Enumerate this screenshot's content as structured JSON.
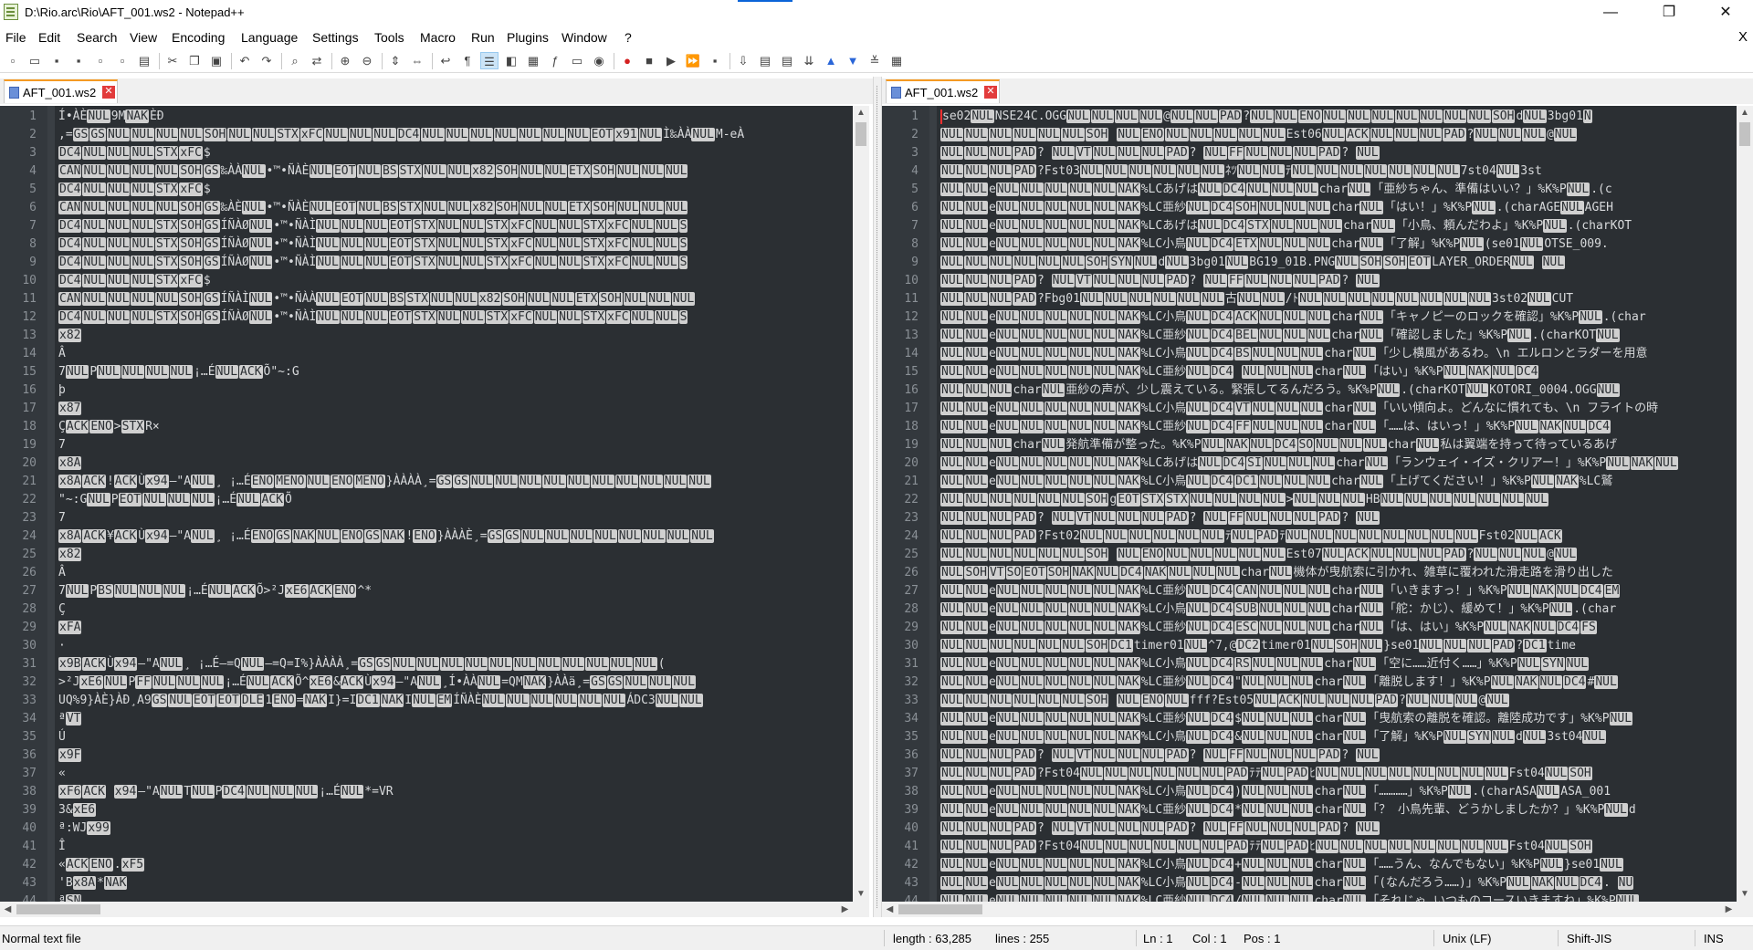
{
  "window": {
    "title": "D:\\Rio.arc\\Rio\\AFT_001.ws2 - Notepad++"
  },
  "menu": [
    "File",
    "Edit",
    "Search",
    "View",
    "Encoding",
    "Language",
    "Settings",
    "Tools",
    "Macro",
    "Run",
    "Plugins",
    "Window",
    "?"
  ],
  "menu_close": "X",
  "toolbar": [
    {
      "icon": "new-file-icon",
      "glyph": "▫"
    },
    {
      "icon": "open-file-icon",
      "glyph": "▭"
    },
    {
      "icon": "save-icon",
      "glyph": "▪"
    },
    {
      "icon": "save-all-icon",
      "glyph": "▪"
    },
    {
      "icon": "close-icon",
      "glyph": "▫"
    },
    {
      "icon": "close-all-icon",
      "glyph": "▫"
    },
    {
      "icon": "print-icon",
      "glyph": "▤"
    },
    {
      "sep": true
    },
    {
      "icon": "cut-icon",
      "glyph": "✂"
    },
    {
      "icon": "copy-icon",
      "glyph": "❐"
    },
    {
      "icon": "paste-icon",
      "glyph": "▣"
    },
    {
      "sep": true
    },
    {
      "icon": "undo-icon",
      "glyph": "↶"
    },
    {
      "icon": "redo-icon",
      "glyph": "↷"
    },
    {
      "sep": true
    },
    {
      "icon": "find-icon",
      "glyph": "⌕"
    },
    {
      "icon": "replace-icon",
      "glyph": "⇄"
    },
    {
      "sep": true
    },
    {
      "icon": "zoom-in-icon",
      "glyph": "⊕"
    },
    {
      "icon": "zoom-out-icon",
      "glyph": "⊖"
    },
    {
      "sep": true
    },
    {
      "icon": "sync-vertical-icon",
      "glyph": "⇕"
    },
    {
      "icon": "sync-horizontal-icon",
      "glyph": "⇔"
    },
    {
      "sep": true
    },
    {
      "icon": "word-wrap-icon",
      "glyph": "↩"
    },
    {
      "icon": "show-all-characters-icon",
      "glyph": "¶"
    },
    {
      "icon": "indent-guide-icon",
      "glyph": "☰",
      "selected": true
    },
    {
      "icon": "language-icon",
      "glyph": "◧"
    },
    {
      "icon": "doc-map-icon",
      "glyph": "▦"
    },
    {
      "icon": "function-list-icon",
      "glyph": "ƒ"
    },
    {
      "icon": "folder-workspace-icon",
      "glyph": "▭"
    },
    {
      "icon": "monitor-icon",
      "glyph": "◉"
    },
    {
      "sep": true
    },
    {
      "icon": "record-macro-icon",
      "glyph": "●",
      "color": "#d42020"
    },
    {
      "icon": "stop-record-icon",
      "glyph": "■"
    },
    {
      "icon": "play-macro-icon",
      "glyph": "▶"
    },
    {
      "icon": "run-macro-multiple-icon",
      "glyph": "⏩"
    },
    {
      "icon": "save-macro-icon",
      "glyph": "▪"
    },
    {
      "sep": true
    },
    {
      "icon": "plugin-1-icon",
      "glyph": "⇩"
    },
    {
      "icon": "plugin-2-icon",
      "glyph": "▤"
    },
    {
      "icon": "plugin-3-icon",
      "glyph": "▤"
    },
    {
      "icon": "plugin-4-icon",
      "glyph": "⇊"
    },
    {
      "icon": "plugin-5-icon",
      "glyph": "▲",
      "color": "#2a66d8"
    },
    {
      "icon": "plugin-6-icon",
      "glyph": "▼",
      "color": "#2a66d8"
    },
    {
      "icon": "plugin-7-icon",
      "glyph": "≚"
    },
    {
      "icon": "plugin-8-icon",
      "glyph": "▦"
    }
  ],
  "left_pane": {
    "tab": "AFT_001.ws2",
    "lines": [
      "  Í•ÀÈ{NUL}9M{NAK}ÈÐ",
      ",={GS}{GS}{NUL}{NUL}{NUL}{NUL}{SOH}{NUL}{NUL}{STX}{xFC}{NUL}{NUL}{NUL}{DC4}{NUL}{NUL}{NUL}{NUL}{NUL}{NUL}{NUL}{EOT}{x91}{NUL}Ì‰ÀÀ{NUL}M-eÀ",
      "{DC4}{NUL}{NUL}{NUL}{STX}{xFC}$",
      "{CAN}{NUL}{NUL}{NUL}{NUL}{SOH}{GS}‰ÀÀ{NUL}•™•ÑÀÈ{NUL}{EOT}{NUL}{BS}{STX}{NUL}{NUL}{x82}{SOH}{NUL}{NUL}{ETX}{SOH}{NUL}{NUL}{NUL}",
      "{DC4}{NUL}{NUL}{NUL}{STX}{xFC}$",
      "{CAN}{NUL}{NUL}{NUL}{NUL}{SOH}{GS}‰ÀÈ{NUL}•™•ÑÀÈ{NUL}{EOT}{NUL}{BS}{STX}{NUL}{NUL}{x82}{SOH}{NUL}{NUL}{ETX}{SOH}{NUL}{NUL}{NUL}",
      "{DC4}{NUL}{NUL}{NUL}{STX}{SOH}{GS}ÍÑÀØ{NUL}•™•ÑÀÌ{NUL}{NUL}{NUL}{EOT}{STX}{NUL}{NUL}{STX}{xFC}{NUL}{NUL}{STX}{xFC}{NUL}{NUL}{S}",
      "{DC4}{NUL}{NUL}{NUL}{STX}{SOH}{GS}ÍÑÀØ{NUL}•™•ÑÀÌ{NUL}{NUL}{NUL}{EOT}{STX}{NUL}{NUL}{STX}{xFC}{NUL}{NUL}{STX}{xFC}{NUL}{NUL}{S}",
      "{DC4}{NUL}{NUL}{NUL}{STX}{SOH}{GS}ÍÑÀØ{NUL}•™•ÑÀÌ{NUL}{NUL}{NUL}{EOT}{STX}{NUL}{NUL}{STX}{xFC}{NUL}{NUL}{STX}{xFC}{NUL}{NUL}{S}",
      "{DC4}{NUL}{NUL}{NUL}{STX}{xFC}$",
      "{CAN}{NUL}{NUL}{NUL}{NUL}{SOH}{GS}ÍÑÀÌ{NUL}•™•ÑÀÀ{NUL}{EOT}{NUL}{BS}{STX}{NUL}{NUL}{x82}{SOH}{NUL}{NUL}{ETX}{SOH}{NUL}{NUL}{NUL}",
      "{DC4}{NUL}{NUL}{NUL}{STX}{SOH}{GS}ÍÑÀØ{NUL}•™•ÑÀÌ{NUL}{NUL}{NUL}{EOT}{STX}{NUL}{NUL}{STX}{xFC}{NUL}{NUL}{STX}{xFC}{NUL}{NUL}{S}",
      "{x82}",
      "Â",
      "7{NUL}P{NUL}{NUL}{NUL}{NUL}¡…É{NUL}{ACK}Õ\"~:G",
      "þ",
      "{x87}",
      "Ç{ACK}{ENO}>{STX}R×",
      "7",
      "{x8A}",
      "{x8A}{ACK}!{ACK}Ù{x94}–\"A{NUL}¸ ¡…É{ENO}{MENO}{NUL}{ENO}{MENO}}ÀÀÀÀ¸={GS}{GS}{NUL}{NUL}{NUL}{NUL}{NUL}{NUL}{NUL}{NUL}{NUL}{NUL}",
      "\"~:G{NUL}P{EOT}{NUL}{NUL}{NUL}¡…É{NUL}{ACK}Õ",
      "7",
      "{x8A}{ACK}¥{ACK}Ù{x94}–\"A{NUL}¸ ¡…É{ENO}{GS}{NAK}{NUL}{ENO}{GS}{NAK}!{ENO}}ÀÀÀÈ¸={GS}{GS}{NUL}{NUL}{NUL}{NUL}{NUL}{NUL}{NUL}{NUL}",
      "{x82}",
      "Â",
      "7{NUL}P{BS}{NUL}{NUL}{NUL}¡…É{NUL}{ACK}Õ>²J{xE6}{ACK}{ENO}^*",
      "Ç",
      "{xFA}",
      "·",
      "{x9B}{ACK}Ù{x94}–\"A{NUL}¸ ¡…É–=Q{NUL}–=Q=I%}ÀÀÀÀ¸={GS}{GS}{NUL}{NUL}{NUL}{NUL}{NUL}{NUL}{NUL}{NUL}{NUL}{NUL}{NUL}(",
      ">²J{xE6}{NUL}P{FF}{NUL}{NUL}{NUL}¡…É{NUL}{ACK}Õ^{xE6}&{ACK}Ù{x94}–\"A{NUL}¸Í•ÀÀ{NUL}=QM{NAK}}ÀÀä¸={GS}{GS}{NUL}{NUL}{NUL}",
      "UQ%9}ÀÈ}ÀÐ¸A9{GS}{NUL}{EOT}{EOT}{DLE}1{ENO}={NAK}I}=I{DC1}{NAK}I{NUL}{EM}ÍÑÀÈ{NUL}{NUL}{NUL}{NUL}{NUL}{NUL}ÁDC3{NUL}{NUL}",
      "ª{VT}",
      "Ú",
      "{x9F}",
      "«",
      "{xF6}{ACK} {x94}–\"A{NUL}T{NUL}P{DC4}{NUL}{NUL}{NUL}¡…É{NUL}*=VR",
      "3&{xE6}",
      "ª:WJ{x99}",
      "Î",
      "«{ACK}{ENO}.{xF5}",
      "'B{x8A}*{NAK}",
      "ª{SN}"
    ]
  },
  "right_pane": {
    "tab": "AFT_001.ws2",
    "lines": [
      "se02{NUL}NSE24C.OGG{NUL}{NUL}{NUL}{NUL}@{NUL}{NUL}{PAD}?{NUL}{NUL}{ENO}{NUL}{NUL}{NUL}{NUL}{NUL}{NUL}{NUL}{SOH}d{NUL}3bg01{N}",
      "{NUL}{NUL}{NUL}{NUL}{NUL}{NUL}{SOH} {NUL}{ENO}{NUL}{NUL}{NUL}{NUL}{NUL}Est06{NUL}{ACK}{NUL}{NUL}{NUL}{PAD}?{NUL}{NUL}{NUL}@{NUL}",
      "{NUL}{NUL}{NUL}{PAD}?  {NUL}{VT}{NUL}{NUL}{NUL}{PAD}?     {NUL}{FF}{NUL}{NUL}{NUL}{PAD}?     {NUL}",
      "{NUL}{NUL}{NUL}{PAD}?Fst03{NUL}{NUL}{NUL}{NUL}{NUL}{NUL}ﾈﾂ{NUL}{NUL}ﾃ{NUL}{NUL}{NUL}{NUL}{NUL}{NUL}{NUL}7st04{NUL}3st",
      "{NUL}{NUL}e{NUL}{NUL}{NUL}{NUL}{NUL}{NAK}%LCあげは{NUL}{DC4}{NUL}{NUL}{NUL}char{NUL}「亜紗ちゃん、準備はいい？」%K%P{NUL}.(c",
      "{NUL}{NUL}e{NUL}{NUL}{NUL}{NUL}{NUL}{NAK}%LC亜紗{NUL}{DC4}{SOH}{NUL}{NUL}{NUL}char{NUL}「はい！」%K%P{NUL}.(charAGE{NUL}AGEH",
      "{NUL}{NUL}e{NUL}{NUL}{NUL}{NUL}{NUL}{NAK}%LCあげは{NUL}{DC4}{STX}{NUL}{NUL}{NUL}char{NUL}「小鳥、頼んだわよ」%K%P{NUL}.(charKOT",
      "{NUL}{NUL}e{NUL}{NUL}{NUL}{NUL}{NUL}{NAK}%LC小鳥{NUL}{DC4}{ETX}{NUL}{NUL}{NUL}char{NUL}「了解」%K%P{NUL}(se01{NUL}OTSE_009.",
      "{NUL}{NUL}{NUL}{NUL}{NUL}{NUL}{SOH}{SYN}{NUL}d{NUL}3bg01{NUL}BG19_01B.PNG{NUL}{SOH}{SOH}{EOT}LAYER_ORDER{NUL} {NUL}",
      "{NUL}{NUL}{NUL}{PAD}?  {NUL}{VT}{NUL}{NUL}{NUL}{PAD}?     {NUL}{FF}{NUL}{NUL}{NUL}{PAD}?     {NUL}",
      "{NUL}{NUL}{NUL}{PAD}?Fbg01{NUL}{NUL}{NUL}{NUL}{NUL}{NUL}古{NUL}{NUL}/ﾄ{NUL}{NUL}{NUL}{NUL}{NUL}{NUL}{NUL}{NUL}3st02{NUL}CUT",
      "{NUL}{NUL}e{NUL}{NUL}{NUL}{NUL}{NUL}{NAK}%LC小鳥{NUL}{DC4}{ACK}{NUL}{NUL}{NUL}char{NUL}「キャノピーのロックを確認」%K%P{NUL}.(char",
      "{NUL}{NUL}e{NUL}{NUL}{NUL}{NUL}{NUL}{NAK}%LC亜紗{NUL}{DC4}{BEL}{NUL}{NUL}{NUL}char{NUL}「確認しました」%K%P{NUL}.(charKOT{NUL}",
      "{NUL}{NUL}e{NUL}{NUL}{NUL}{NUL}{NUL}{NAK}%LC小鳥{NUL}{DC4}{BS}{NUL}{NUL}{NUL}char{NUL}「少し横風があるわ。\\n エルロンとラダーを用意",
      "{NUL}{NUL}e{NUL}{NUL}{NUL}{NUL}{NUL}{NAK}%LC亜紗{NUL}{DC4}  {NUL}{NUL}{NUL}char{NUL}「はい」%K%P{NUL}{NAK}{NUL}{DC4}",
      "{NUL}{NUL}{NUL}char{NUL}亜紗の声が、少し震えている。緊張してるんだろう。%K%P{NUL}.(charKOT{NUL}KOTORI_0004.OGG{NUL}",
      "{NUL}{NUL}e{NUL}{NUL}{NUL}{NUL}{NUL}{NAK}%LC小鳥{NUL}{DC4}{VT}{NUL}{NUL}{NUL}char{NUL}「いい傾向よ。どんなに慣れても、\\n フライトの時",
      "{NUL}{NUL}e{NUL}{NUL}{NUL}{NUL}{NUL}{NAK}%LC亜紗{NUL}{DC4}{FF}{NUL}{NUL}{NUL}char{NUL}「……は、はいっ！」%K%P{NUL}{NAK}{NUL}{DC4}",
      "{NUL}{NUL}{NUL}char{NUL}発航準備が整った。%K%P{NUL}{NAK}{NUL}{DC4}{SO}{NUL}{NUL}{NUL}char{NUL}私は翼端を持って待っているあげ",
      "{NUL}{NUL}e{NUL}{NUL}{NUL}{NUL}{NUL}{NAK}%LCあげは{NUL}{DC4}{SI}{NUL}{NUL}{NUL}char{NUL}「ランウェイ・イズ・クリアー！」%K%P{NUL}{NAK}{NUL}",
      "{NUL}{NUL}e{NUL}{NUL}{NUL}{NUL}{NUL}{NAK}%LC小鳥{NUL}{DC4}{DC1}{NUL}{NUL}{NUL}char{NUL}「上げてください！」%K%P{NUL}{NAK}%LC鷲",
      "{NUL}{NUL}{NUL}{NUL}{NUL}{NUL}{SOH}g{EOT}{STX}{STX}{NUL}{NUL}{NUL}{NUL}>{NUL}{NUL}{NUL}HB{NUL}{NUL}{NUL}{NUL}{NUL}{NUL}{NUL}",
      "{NUL}{NUL}{NUL}{PAD}?  {NUL}{VT}{NUL}{NUL}{NUL}{PAD}?     {NUL}{FF}{NUL}{NUL}{NUL}{PAD}?     {NUL}",
      "{NUL}{NUL}{NUL}{PAD}?Fst02{NUL}{NUL}{NUL}{NUL}{NUL}{NUL}ﾃ{NUL}{PAD}ﾃ{NUL}{NUL}{NUL}{NUL}{NUL}{NUL}{NUL}{NUL}Fst02{NUL}{ACK}",
      "{NUL}{NUL}{NUL}{NUL}{NUL}{NUL}{SOH} {NUL}{ENO}{NUL}{NUL}{NUL}{NUL}{NUL}Est07{NUL}{ACK}{NUL}{NUL}{NUL}{PAD}?{NUL}{NUL}{NUL}@{NUL}",
      "{NUL}{SOH}{VT}{SO}{EOT}{SOH}{NAK}{NUL}{DC4}{NAK}{NUL}{NUL}{NUL}char{NUL}機体が曳航索に引かれ、雑草に覆われた滑走路を滑り出した",
      "{NUL}{NUL}e{NUL}{NUL}{NUL}{NUL}{NUL}{NAK}%LC亜紗{NUL}{DC4}{CAN}{NUL}{NUL}{NUL}char{NUL}「いきますっ！」%K%P{NUL}{NAK}{NUL}{DC4}{EM}",
      "{NUL}{NUL}e{NUL}{NUL}{NUL}{NUL}{NUL}{NAK}%LC小鳥{NUL}{DC4}{SUB}{NUL}{NUL}{NUL}char{NUL}「舵：かじ）、緩めて！」%K%P{NUL}.(char",
      "{NUL}{NUL}e{NUL}{NUL}{NUL}{NUL}{NUL}{NAK}%LC亜紗{NUL}{DC4}{ESC}{NUL}{NUL}{NUL}char{NUL}「は、はい」%K%P{NUL}{NAK}{NUL}{DC4}{FS}",
      "{NUL}{NUL}{NUL}{NUL}{NUL}{NUL}{SOH}{DC1}timer01{NUL}^7,@{DC2}timer01{NUL}{SOH}{NUL}}se01{NUL}{NUL}{NUL}{PAD}?{DC1}time",
      "{NUL}{NUL}e{NUL}{NUL}{NUL}{NUL}{NUL}{NAK}%LC小鳥{NUL}{DC4}{RS}{NUL}{NUL}{NUL}char{NUL}「空に……近付く……」%K%P{NUL}{SYN}{NUL}",
      "{NUL}{NUL}e{NUL}{NUL}{NUL}{NUL}{NUL}{NAK}%LC亜紗{NUL}{DC4}\"{NUL}{NUL}{NUL}char{NUL}「離脱します！」%K%P{NUL}{NAK}{NUL}{DC4}#{NUL}",
      "{NUL}{NUL}{NUL}{NUL}{NUL}{NUL}{SOH} {NUL}{ENO}{NUL}fff?Est05{NUL}{ACK}{NUL}{NUL}{NUL}{PAD}?{NUL}{NUL}{NUL}@{NUL}",
      "{NUL}{NUL}e{NUL}{NUL}{NUL}{NUL}{NUL}{NAK}%LC亜紗{NUL}{DC4}${NUL}{NUL}{NUL}char{NUL}「曳航索の離脱を確認。離陸成功です」%K%P{NUL}",
      "{NUL}{NUL}e{NUL}{NUL}{NUL}{NUL}{NUL}{NAK}%LC小鳥{NUL}{DC4}&{NUL}{NUL}{NUL}char{NUL}「了解」%K%P{NUL}{SYN}{NUL}d{NUL}3st04{NUL}",
      "{NUL}{NUL}{NUL}{PAD}?  {NUL}{VT}{NUL}{NUL}{NUL}{PAD}?     {NUL}{FF}{NUL}{NUL}{NUL}{PAD}?     {NUL}",
      "{NUL}{NUL}{NUL}{PAD}?Fst04{NUL}{NUL}{NUL}{NUL}{NUL}{NUL}{PAD}ﾃﾃ{NUL}{PAD}ﾋ{NUL}{NUL}{NUL}{NUL}{NUL}{NUL}{NUL}{NUL}Fst04{NUL}{SOH}",
      "{NUL}{NUL}e{NUL}{NUL}{NUL}{NUL}{NUL}{NAK}%LC小鳥{NUL}{DC4}){NUL}{NUL}{NUL}char{NUL}「…………」%K%P{NUL}.(charASA{NUL}ASA_001",
      "{NUL}{NUL}e{NUL}{NUL}{NUL}{NUL}{NUL}{NAK}%LC亜紗{NUL}{DC4}*{NUL}{NUL}{NUL}char{NUL}「？ 小鳥先輩、どうかしましたか？」%K%P{NUL}d",
      "{NUL}{NUL}{NUL}{PAD}?  {NUL}{VT}{NUL}{NUL}{NUL}{PAD}?     {NUL}{FF}{NUL}{NUL}{NUL}{PAD}?     {NUL}",
      "{NUL}{NUL}{NUL}{PAD}?Fst04{NUL}{NUL}{NUL}{NUL}{NUL}{NUL}{PAD}ﾃﾃ{NUL}{PAD}ﾋ{NUL}{NUL}{NUL}{NUL}{NUL}{NUL}{NUL}{NUL}Fst04{NUL}{SOH}",
      "{NUL}{NUL}e{NUL}{NUL}{NUL}{NUL}{NUL}{NAK}%LC小鳥{NUL}{DC4}+{NUL}{NUL}{NUL}char{NUL}「……うん、なんでもない」%K%P{NUL}}se01{NUL}",
      "{NUL}{NUL}e{NUL}{NUL}{NUL}{NUL}{NUL}{NAK}%LC小鳥{NUL}{DC4}-{NUL}{NUL}{NUL}char{NUL}「(なんだろう……)」%K%P{NUL}{NAK}{NUL}{DC4}. {NU}",
      "{NUL}{NUL}e{NUL}{NUL}{NUL}{NUL}{NUL}{NAK}%LC亜紗{NUL}{DC4}/{NUL}{NUL}{NUL}char{NUL}「それじゃ いつものコースいきますね」%K%P{NUL}"
    ]
  },
  "status": {
    "file_type": "Normal text file",
    "length": "length : 63,285",
    "lines": "lines : 255",
    "ln": "Ln : 1",
    "col": "Col : 1",
    "pos": "Pos : 1",
    "eol": "Unix (LF)",
    "encoding": "Shift-JIS",
    "mode": "INS"
  }
}
